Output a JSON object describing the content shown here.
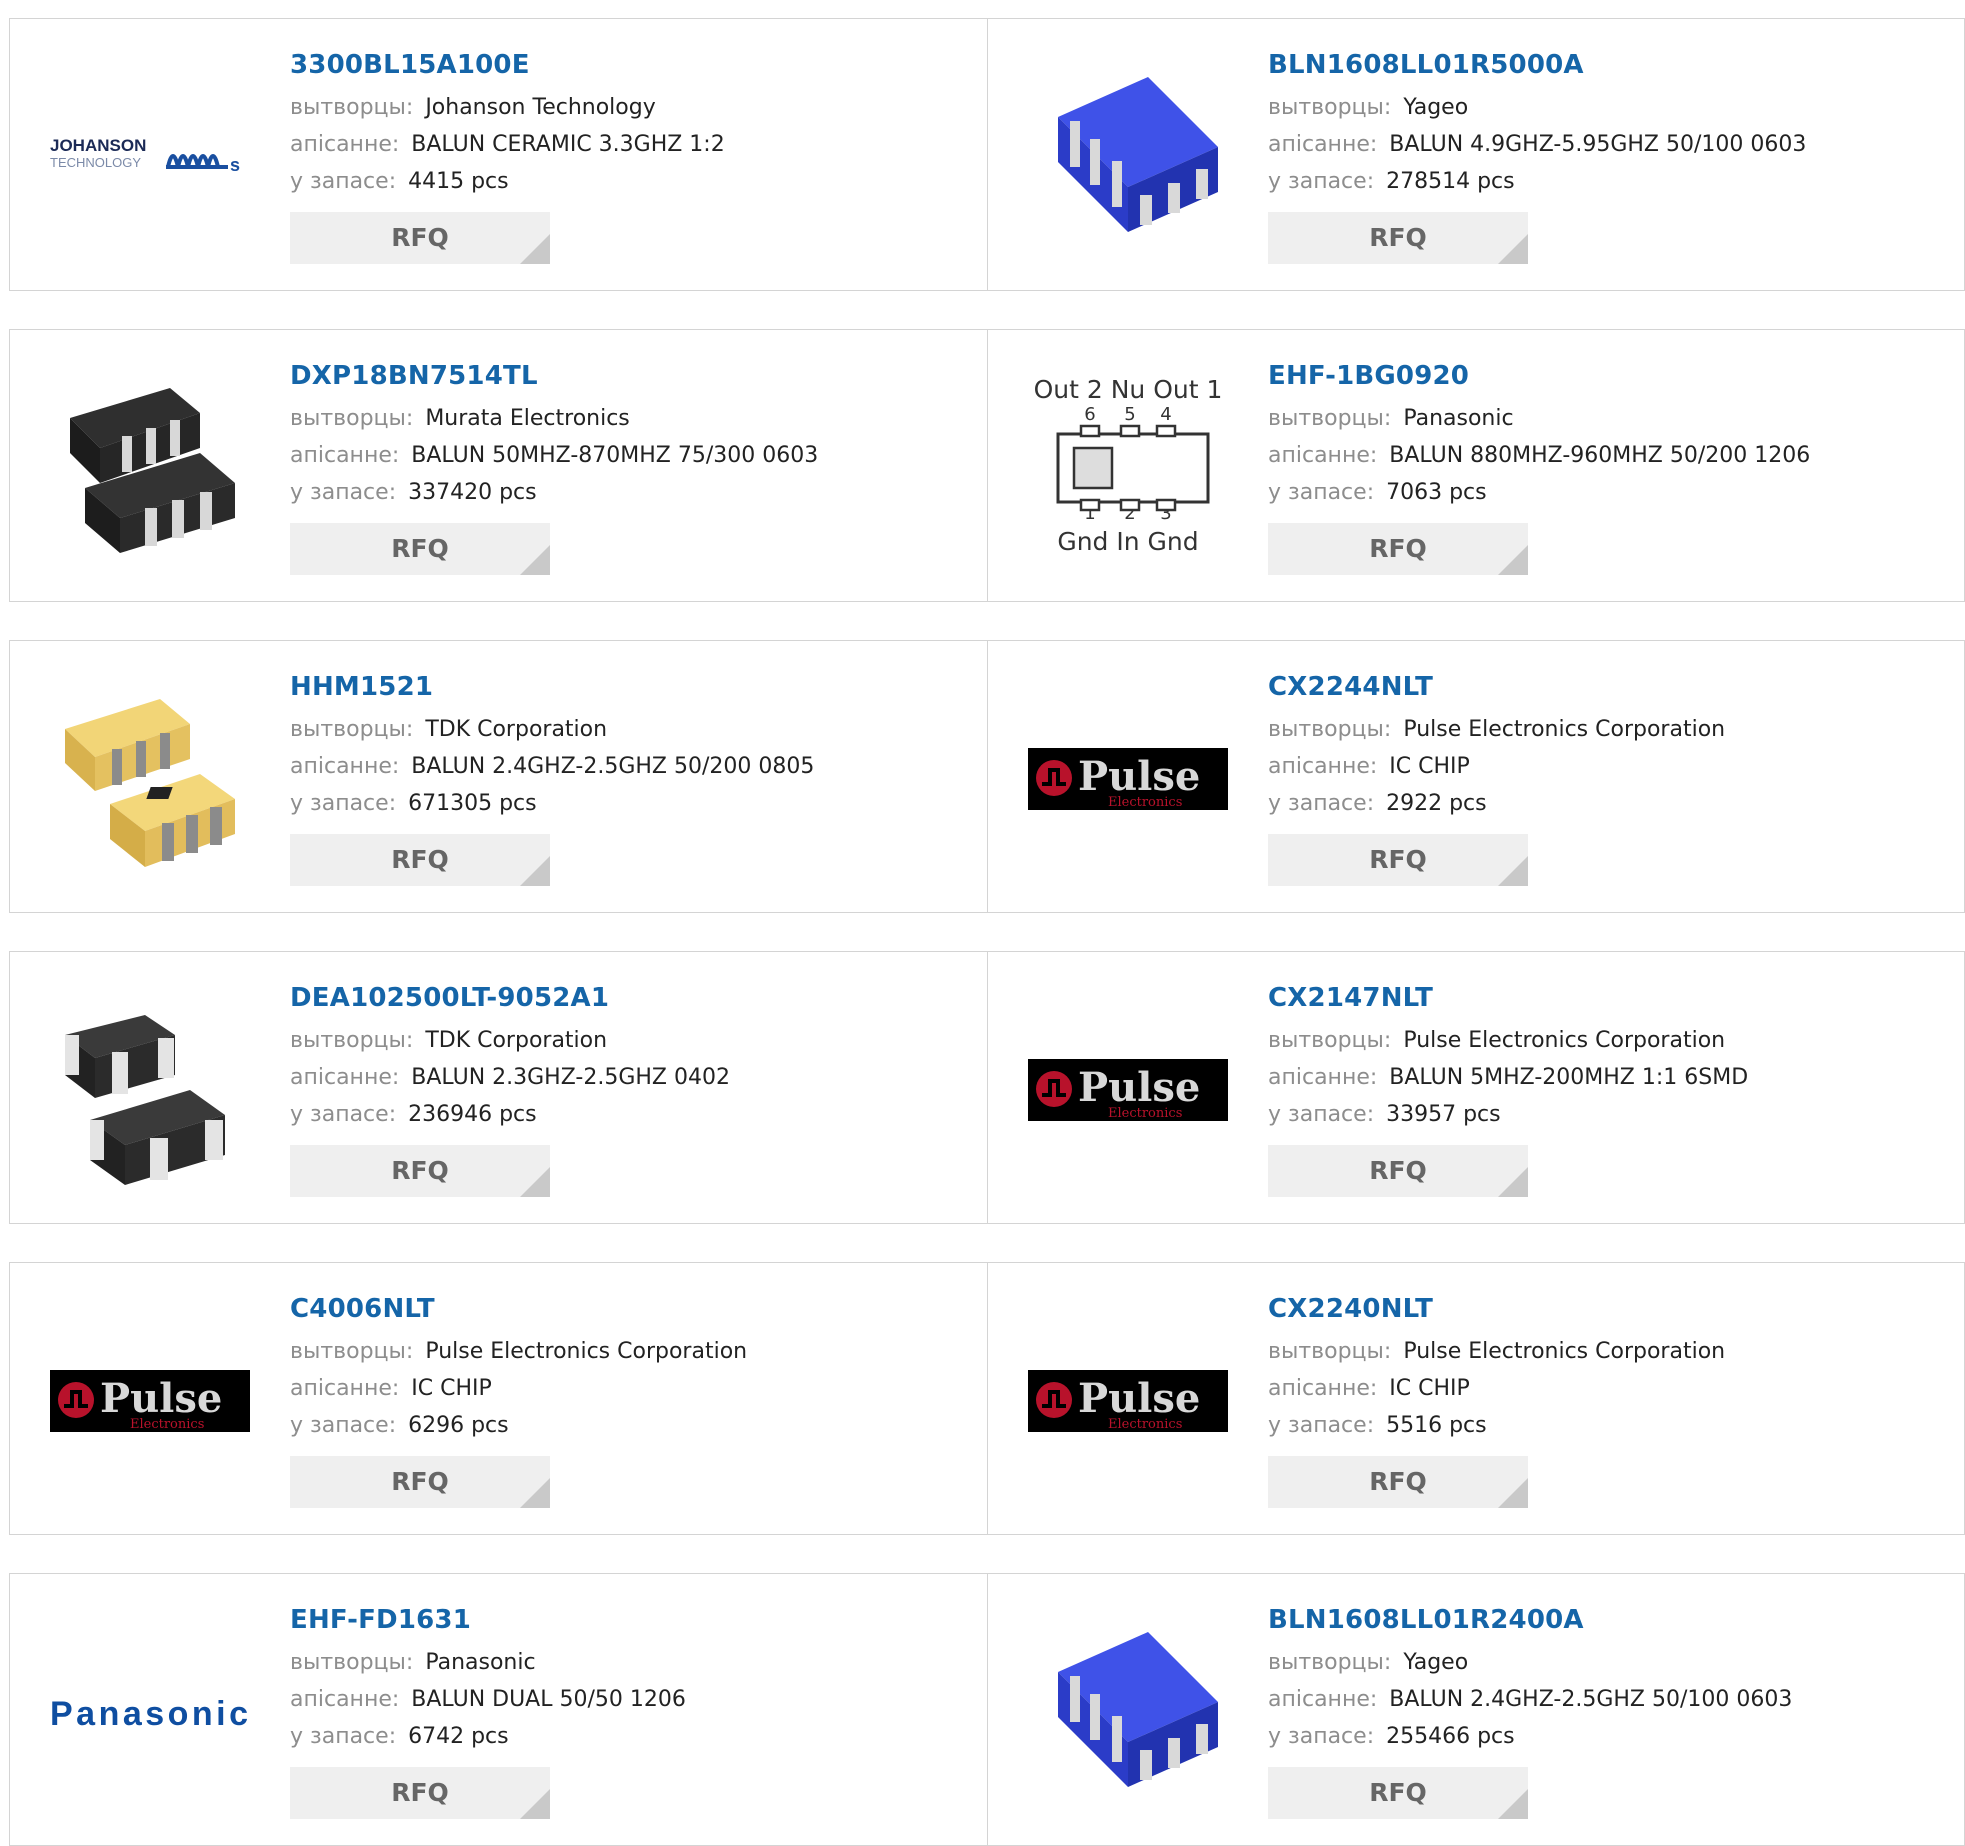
{
  "labels": {
    "manufacturer": "вытворцы:",
    "description": "апісанне:",
    "stock": "у запасе:",
    "rfq": "RFQ"
  },
  "rows": [
    [
      {
        "part": "3300BL15A100E",
        "manufacturer": "Johanson Technology",
        "description": "BALUN CERAMIC 3.3GHZ 1:2",
        "stock": "4415 pcs",
        "image": "johanson-logo"
      },
      {
        "part": "BLN1608LL01R5000A",
        "manufacturer": "Yageo",
        "description": "BALUN 4.9GHZ-5.95GHZ 50/100 0603",
        "stock": "278514 pcs",
        "image": "blue-chip"
      }
    ],
    [
      {
        "part": "DXP18BN7514TL",
        "manufacturer": "Murata Electronics",
        "description": "BALUN 50MHZ-870MHZ 75/300 0603",
        "stock": "337420 pcs",
        "image": "black-chip"
      },
      {
        "part": "EHF-1BG0920",
        "manufacturer": "Panasonic",
        "description": "BALUN 880MHZ-960MHZ 50/200 1206",
        "stock": "7063 pcs",
        "image": "pinout-diagram"
      }
    ],
    [
      {
        "part": "HHM1521",
        "manufacturer": "TDK Corporation",
        "description": "BALUN 2.4GHZ-2.5GHZ 50/200 0805",
        "stock": "671305 pcs",
        "image": "yellow-chip"
      },
      {
        "part": "CX2244NLT",
        "manufacturer": "Pulse Electronics Corporation",
        "description": "IC CHIP",
        "stock": "2922 pcs",
        "image": "pulse-logo"
      }
    ],
    [
      {
        "part": "DEA102500LT-9052A1",
        "manufacturer": "TDK Corporation",
        "description": "BALUN 2.3GHZ-2.5GHZ 0402",
        "stock": "236946 pcs",
        "image": "black-white-chip"
      },
      {
        "part": "CX2147NLT",
        "manufacturer": "Pulse Electronics Corporation",
        "description": "BALUN 5MHZ-200MHZ 1:1 6SMD",
        "stock": "33957 pcs",
        "image": "pulse-logo"
      }
    ],
    [
      {
        "part": "C4006NLT",
        "manufacturer": "Pulse Electronics Corporation",
        "description": "IC CHIP",
        "stock": "6296 pcs",
        "image": "pulse-logo"
      },
      {
        "part": "CX2240NLT",
        "manufacturer": "Pulse Electronics Corporation",
        "description": "IC CHIP",
        "stock": "5516 pcs",
        "image": "pulse-logo"
      }
    ],
    [
      {
        "part": "EHF-FD1631",
        "manufacturer": "Panasonic",
        "description": "BALUN DUAL 50/50 1206",
        "stock": "6742 pcs",
        "image": "panasonic-logo"
      },
      {
        "part": "BLN1608LL01R2400A",
        "manufacturer": "Yageo",
        "description": "BALUN 2.4GHZ-2.5GHZ 50/100 0603",
        "stock": "255466 pcs",
        "image": "blue-chip"
      }
    ]
  ],
  "logos": {
    "johanson": {
      "line1": "JOHANSON",
      "line2": "TECHNOLOGY"
    },
    "pulse": {
      "word": "Pulse",
      "sub": "Electronics"
    },
    "panasonic": "Panasonic",
    "pinout": {
      "top": "Out 2  Nu  Out 1",
      "top_pins": "6     5     4",
      "bottom_pins": "1     2     3",
      "bottom": "Gnd   In   Gnd"
    }
  },
  "colors": {
    "link": "#1565a8",
    "label": "#8d8d8d",
    "button_bg": "#efefef",
    "border": "#d4d4d4"
  }
}
